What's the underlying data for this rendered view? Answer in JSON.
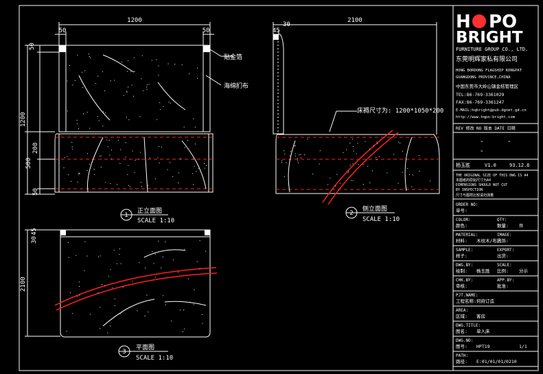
{
  "logo": {
    "line1_left": "H",
    "line1_right": "PO",
    "line2": "BRIGHT",
    "group": "FURNITURE GROUP CO., LTD.",
    "company_cn": "东莞明辉家私有限公司"
  },
  "company_info": [
    "HONG BORDONG FLAGSHIP KONGPAT",
    "GUANGDONG PROVINCE,CHINA",
    "中国东莞市大岭山镇金桔管理区",
    "TEL:86-769-3361029",
    "FAX:86-769-3361247",
    "E-MAIL:hqbright@pub.dgnet.gd.cn",
    "http://www.hqpo-bright.com"
  ],
  "revision_header": "REV 修改  NO 版本  DATE 日期",
  "approval": {
    "name": "杨玉胜",
    "version": "V1.0",
    "date": "93.12.6"
  },
  "copyright_lines": [
    "THE ORIGINAL SIZE OF THIS DWG IS A4",
    "本图纸的原始尺寸为A4",
    "DIMENSIONS SHOULD NOT CUT",
    "BY INSPECTION",
    "尺寸与图样比较请勿测量"
  ],
  "title_block": [
    {
      "en": "ORDER NO:",
      "cn": "单号:",
      "value": ""
    },
    {
      "en": "COLOR:",
      "cn": "颜色:",
      "qty_en": "QTY:",
      "qty_cn": "数量:",
      "value": "件"
    },
    {
      "en": "MATERIAL:",
      "cn": "材料:",
      "value": "木纹木/布艺",
      "extra_en": "IMAGE:",
      "extra_cn": "内饰:"
    },
    {
      "en": "SAMPLE:",
      "cn": "样子:",
      "value": "",
      "extra_en": "EXPORT:",
      "extra_cn": "出货:"
    },
    {
      "en": "DWG.BY:",
      "cn": "绘制:",
      "value": "杨玉胜",
      "extra_en": "SCALE:",
      "extra_cn": "比例:",
      "extra_value": "分示"
    },
    {
      "en": "CHK.BY:",
      "cn": "审核:",
      "value": "",
      "extra_en": "APP.BY:",
      "extra_cn": "批准:"
    },
    {
      "en": "PJT.NAME:",
      "cn": "工程名称:",
      "value": "何府订造"
    },
    {
      "en": "AREA:",
      "cn": "区域:",
      "value": "客房"
    },
    {
      "en": "DWG.TITLE:",
      "cn": "图名:",
      "value": "单人床"
    },
    {
      "en": "DWG.NO:",
      "cn": "图号:",
      "value": "HPT19",
      "extra_value": "1/1"
    },
    {
      "en": "PATH:",
      "cn": "路径:",
      "value": "E:01/01/01/0210"
    }
  ],
  "views": [
    {
      "number": "1",
      "title": "正立面图",
      "scale": "SCALE 1:10"
    },
    {
      "number": "2",
      "title": "侧立面图",
      "scale": "SCALE 1:10"
    },
    {
      "number": "3",
      "title": "平面图",
      "scale": "SCALE 1:10"
    }
  ],
  "front_dims": {
    "total_width": "1200",
    "left_post": "50",
    "right_post": "50",
    "top": "50",
    "height": "1200",
    "mid": "200",
    "base": "500",
    "bottom": "50"
  },
  "side_dims": {
    "depth": "2100",
    "post": "45",
    "offset": "30"
  },
  "plan_dims": {
    "depth": "2100",
    "a": "30",
    "b": "45"
  },
  "annotations": {
    "cap": "贴金箔",
    "upholstery": "海绵扪布",
    "mattress": "床褥尺寸为: 1200*1050*200"
  },
  "colors": {
    "line": "#ffffff",
    "accent": "#ff2020",
    "dim": "#e0e000",
    "highlight": "#ff3030"
  }
}
